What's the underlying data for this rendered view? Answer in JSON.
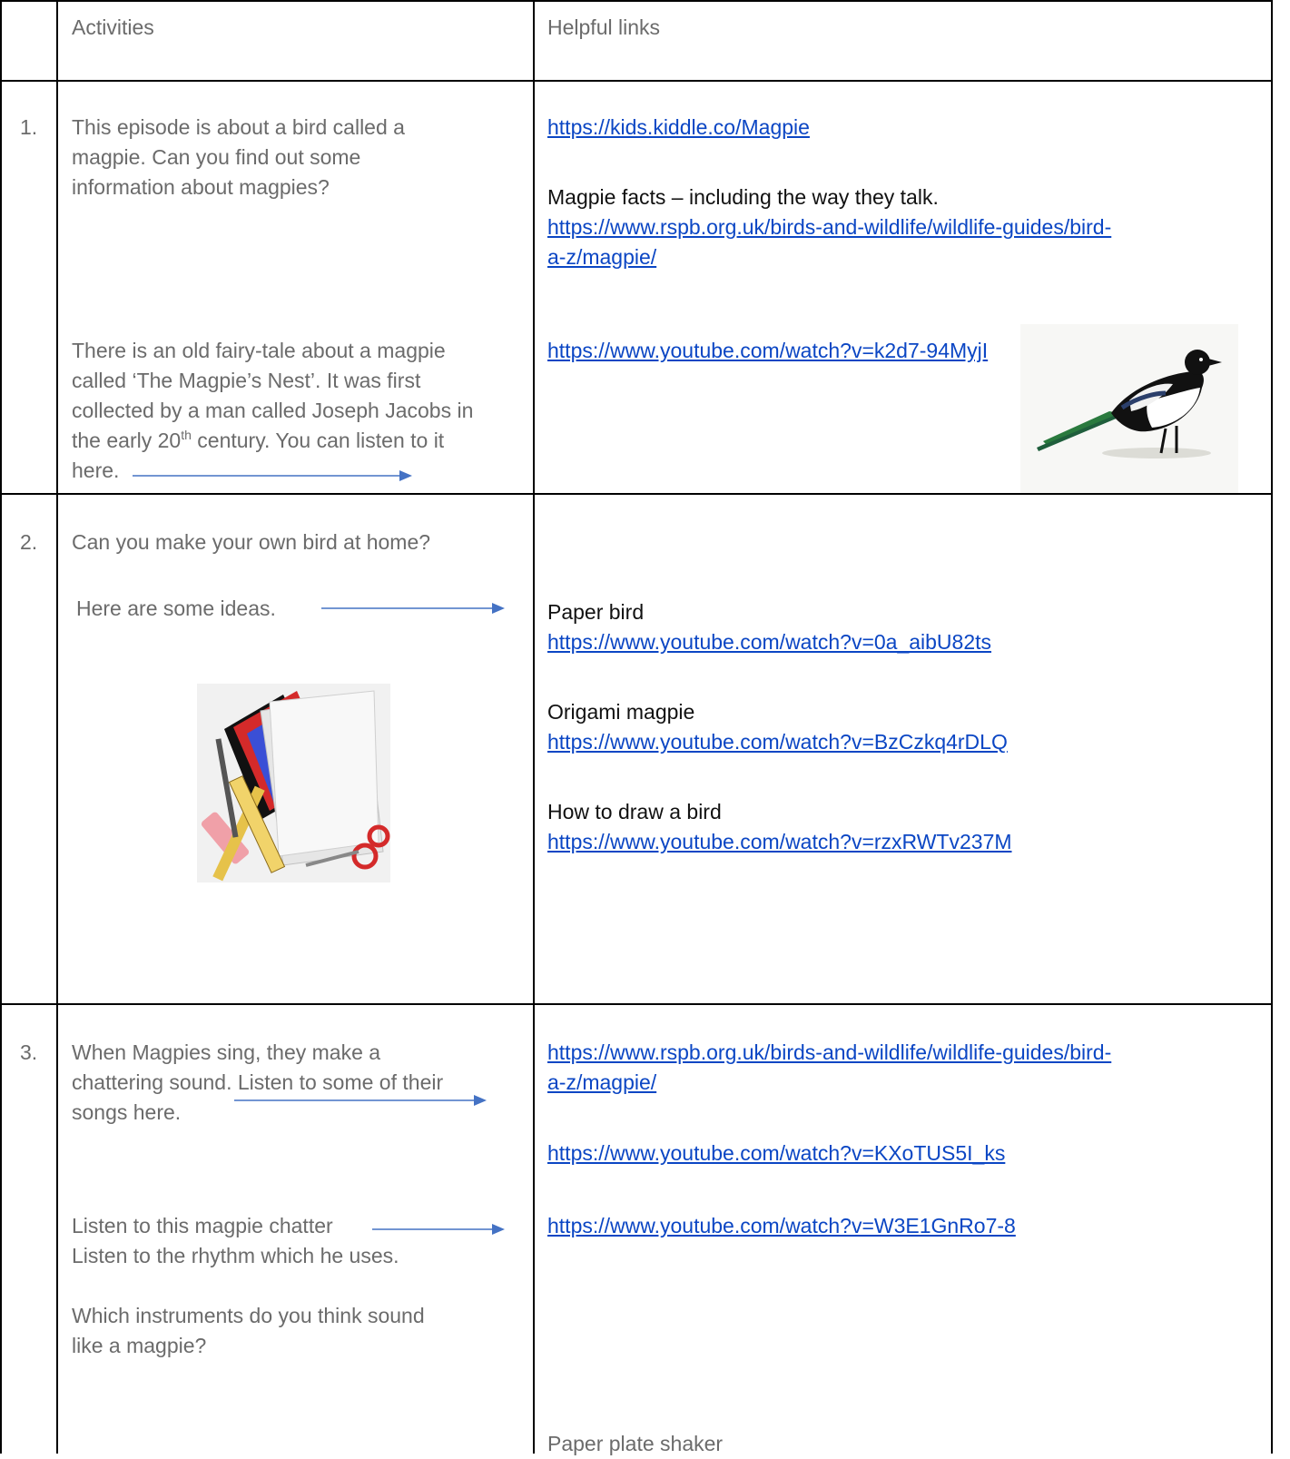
{
  "header": {
    "num": "",
    "activities": "Activities",
    "links": "Helpful links"
  },
  "rows": [
    {
      "num": "1.",
      "activity_1": [
        "This episode is about a bird called a",
        "magpie.  Can you find out some",
        "information about magpies?"
      ],
      "activity_2": [
        "There is an old fairy-tale about a magpie",
        "called ‘The Magpie’s Nest’.  It was first",
        "collected by a man called Joseph Jacobs in"
      ],
      "activity_2_line4_pre": "the early 20",
      "activity_2_line4_sup": "th",
      "activity_2_line4_post": " century.  You can listen to it",
      "activity_2_line5": "here.",
      "link_1": "https://kids.kiddle.co/Magpie",
      "facts_label": "Magpie facts – including the way they talk.",
      "link_2_line1": "https://www.rspb.org.uk/birds-and-wildlife/wildlife-guides/bird-",
      "link_2_line2": "a-z/magpie/",
      "link_3": "https://www.youtube.com/watch?v=k2d7-94MyjI",
      "image": "magpie-bird-illustration"
    },
    {
      "num": "2.",
      "activity_1": "Can you make your own bird at home?",
      "activity_2": "Here are some ideas.",
      "image": "craft-supplies-clipart",
      "link_items": [
        {
          "label": "Paper bird",
          "url": "https://www.youtube.com/watch?v=0a_aibU82ts"
        },
        {
          "label": "Origami magpie",
          "url": "https://www.youtube.com/watch?v=BzCzkq4rDLQ"
        },
        {
          "label": "How to draw a bird",
          "url": "https://www.youtube.com/watch?v=rzxRWTv237M"
        }
      ]
    },
    {
      "num": "3.",
      "activity_1": [
        "When Magpies sing, they make a",
        "chattering sound.  Listen to some of their",
        "songs here."
      ],
      "activity_2": [
        "Listen to this magpie chatter",
        "Listen to the rhythm which he uses."
      ],
      "activity_3": [
        "Which instruments do you think sound",
        "like a magpie?"
      ],
      "link_1_line1": "https://www.rspb.org.uk/birds-and-wildlife/wildlife-guides/bird-",
      "link_1_line2": "a-z/magpie/",
      "link_2": "https://www.youtube.com/watch?v=KXoTUS5I_ks",
      "link_3": "https://www.youtube.com/watch?v=W3E1GnRo7-8",
      "bottom_label": "Paper plate shaker"
    }
  ],
  "colors": {
    "link": "#0b46c4",
    "activity_text": "#6b6b6b",
    "arrow": "#4472c4",
    "grid": "#000000"
  }
}
